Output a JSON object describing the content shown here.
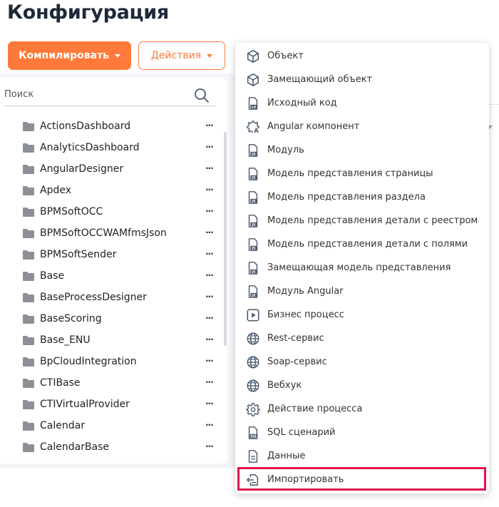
{
  "page": {
    "title": "Конфигурация"
  },
  "toolbar": {
    "compile_label": "Компилировать",
    "actions_label": "Действия"
  },
  "search": {
    "placeholder": "Поиск",
    "value": ""
  },
  "packages": [
    "ActionsDashboard",
    "AnalyticsDashboard",
    "AngularDesigner",
    "Apdex",
    "BPMSoftOCC",
    "BPMSoftOCCWAMfmsJson",
    "BPMSoftSender",
    "Base",
    "BaseProcessDesigner",
    "BaseScoring",
    "Base_ENU",
    "BpCloudIntegration",
    "CTIBase",
    "CTIVirtualProvider",
    "Calendar",
    "CalendarBase"
  ],
  "package_more_label": "···",
  "add_menu": {
    "items": [
      {
        "label": "Объект",
        "icon": "cube-icon"
      },
      {
        "label": "Замещающий объект",
        "icon": "cube-icon"
      },
      {
        "label": "Исходный код",
        "icon": "csharp-file-icon"
      },
      {
        "label": "Angular компонент",
        "icon": "angular-gear-icon"
      },
      {
        "label": "Модуль",
        "icon": "js-file-icon"
      },
      {
        "label": "Модель представления страницы",
        "icon": "js-file-icon"
      },
      {
        "label": "Модель представления раздела",
        "icon": "js-file-icon"
      },
      {
        "label": "Модель представления детали с реестром",
        "icon": "js-file-icon"
      },
      {
        "label": "Модель представления детали с полями",
        "icon": "js-file-icon"
      },
      {
        "label": "Замещающая модель представления",
        "icon": "js-file-icon"
      },
      {
        "label": "Модуль Angular",
        "icon": "js-file-icon"
      },
      {
        "label": "Бизнес процесс",
        "icon": "play-icon"
      },
      {
        "label": "Rest-сервис",
        "icon": "globe-icon"
      },
      {
        "label": "Soap-сервис",
        "icon": "globe-icon"
      },
      {
        "label": "Вебхук",
        "icon": "globe-icon"
      },
      {
        "label": "Действие процесса",
        "icon": "gear-icon"
      },
      {
        "label": "SQL сценарий",
        "icon": "sql-file-icon"
      },
      {
        "label": "Данные",
        "icon": "data-file-icon"
      },
      {
        "label": "Импортировать",
        "icon": "import-icon"
      }
    ],
    "highlighted_item": "Импортировать"
  },
  "colors": {
    "accent": "#ff7a3a",
    "highlight": "#e0164a",
    "icon": "#4a5a6e",
    "folder": "#8c9096"
  }
}
